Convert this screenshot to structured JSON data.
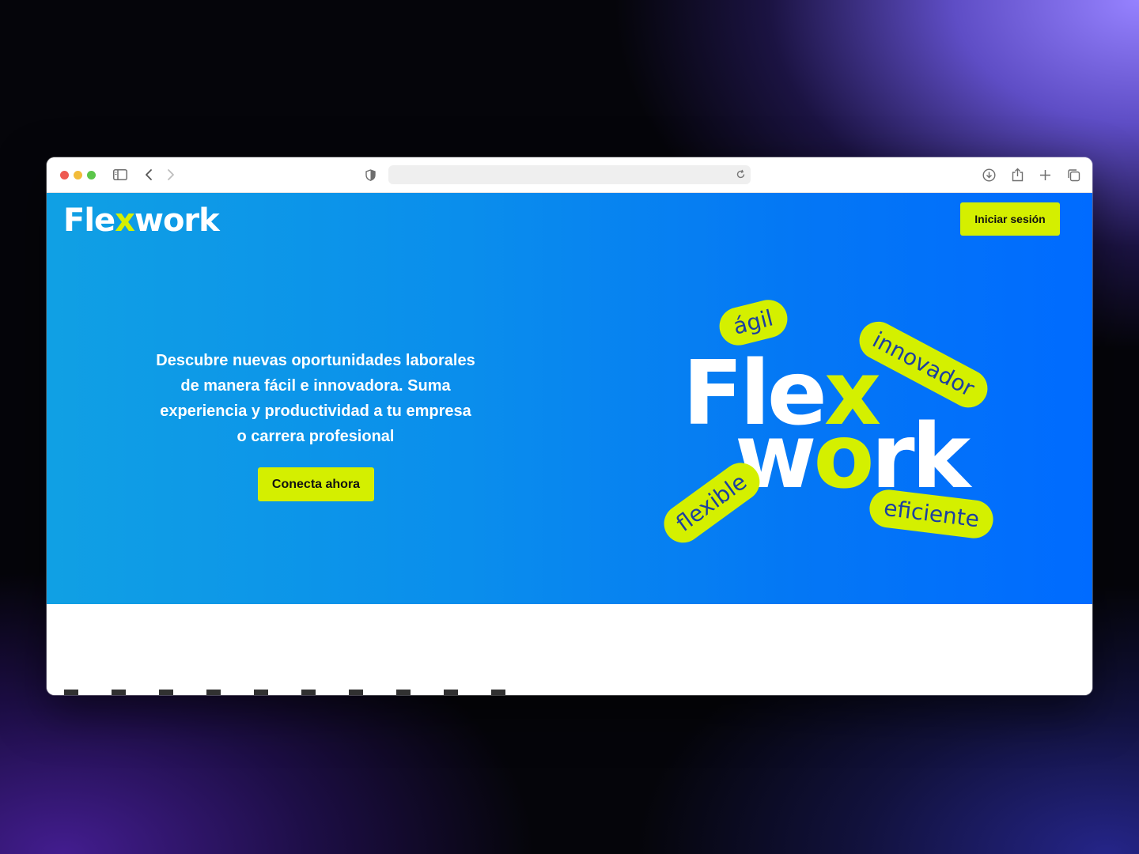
{
  "browser": {
    "controls": [
      "close",
      "minimize",
      "zoom"
    ],
    "toolbar_icons": [
      "sidebar-icon",
      "back-icon",
      "forward-icon",
      "shield-icon",
      "reload-icon",
      "download-icon",
      "share-icon",
      "new-tab-icon",
      "tabs-overview-icon"
    ],
    "address": ""
  },
  "header": {
    "logo_pre": "Fle",
    "logo_x": "x",
    "logo_post": "work",
    "login_label": "Iniciar sesión"
  },
  "hero": {
    "text_line1": "Descubre nuevas oportunidades laborales",
    "text_line2": "de manera fácil e innovadora. Suma",
    "text_line3": "experiencia y productividad a tu empresa",
    "text_line4": "o carrera profesional",
    "cta_label": "Conecta ahora"
  },
  "art": {
    "word1_pre": "Fle",
    "word1_x": "x",
    "word2_pre": "w",
    "word2_o": "o",
    "word2_post": "rk",
    "pills": [
      "ágil",
      "innovador",
      "flexible",
      "eficiente"
    ]
  },
  "colors": {
    "accent": "#d4ef00",
    "hero_start": "#10a0e4",
    "hero_end": "#006bff",
    "pill_text": "#1c3fa0"
  }
}
